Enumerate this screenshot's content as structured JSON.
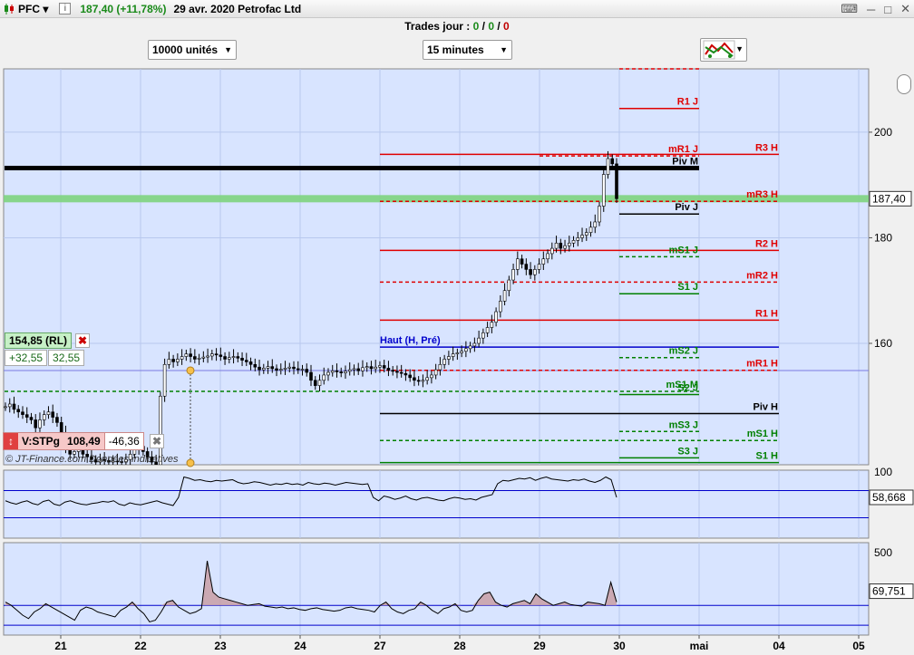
{
  "titlebar": {
    "symbol": "PFC",
    "info_icon": "i",
    "quote": "187,40 (+11,78%)",
    "date_name": "29 avr. 2020 Petrofac Ltd",
    "icons": [
      "keyboard-icon",
      "minimize-icon",
      "maximize-icon",
      "close-icon"
    ]
  },
  "trades": {
    "label": "Trades jour : ",
    "v1": "0",
    "sep1": " / ",
    "v2": "0",
    "sep2": " / ",
    "v3": "0"
  },
  "toolbar": {
    "quantity": "10000 unités",
    "timeframe": "15 minutes"
  },
  "rl_panel": {
    "label": "154,85 (RL)",
    "v1": "+32,55",
    "v2": "32,55",
    "close": "✖"
  },
  "stpg_panel": {
    "label": "V:STPg",
    "v1": "108,49",
    "v2": "-46,36",
    "close": "✖"
  },
  "copyright": "© JT-Finance.com  Données indicatives",
  "colors": {
    "bg": "#d8e4ff",
    "red": "#e00000",
    "green": "#008000",
    "blue": "#0000cc",
    "black": "#000000",
    "highlight": "#7ed37e"
  },
  "chart_data": [
    {
      "type": "line",
      "series_type": "candlestick",
      "x_ticks": [
        "21",
        "22",
        "23",
        "24",
        "27",
        "28",
        "29",
        "30",
        "mai",
        "04",
        "05"
      ],
      "y_ticks": [
        160,
        180,
        200
      ],
      "ylim": [
        137,
        212
      ],
      "last_price_label": "187,40",
      "close": [
        148,
        148.5,
        147.5,
        147,
        146.5,
        146,
        145.5,
        144,
        145.5,
        146.5,
        147,
        146,
        145,
        143,
        140,
        139,
        139.5,
        140,
        139,
        138.5,
        138,
        137.5,
        138,
        137.8,
        137.5,
        137.7,
        137.6,
        137.5,
        138,
        139,
        140,
        140.5,
        139.5,
        138.5,
        137.5,
        137,
        150,
        156,
        157,
        156.5,
        157,
        157.5,
        158,
        157.5,
        157,
        157.2,
        157.4,
        157.6,
        158,
        157.8,
        157.5,
        157,
        157.3,
        157.5,
        157.2,
        156.8,
        156.5,
        156,
        155.5,
        155,
        155.3,
        155.6,
        155.2,
        154.9,
        155.1,
        155.3,
        155.5,
        155.2,
        155,
        155.1,
        154.5,
        153,
        152,
        153,
        154,
        154.5,
        154.8,
        154.6,
        154.4,
        154.7,
        155,
        155.2,
        154.8,
        155.4,
        155.6,
        155.2,
        155.5,
        155.8,
        155.3,
        154.9,
        154.7,
        154.5,
        154.3,
        154,
        153.5,
        153,
        152.8,
        153,
        153.5,
        154,
        155,
        156,
        157,
        157.5,
        158,
        158.2,
        158.5,
        159,
        159.5,
        160,
        161,
        162,
        163,
        164,
        166,
        168,
        170,
        172,
        174,
        176,
        175,
        174,
        173,
        174,
        175,
        176,
        177,
        178,
        179,
        178,
        178.5,
        179,
        179.5,
        180,
        180.5,
        181,
        182,
        183,
        186,
        192,
        195,
        194,
        187.4
      ],
      "levels": [
        {
          "name": "R1 J",
          "value": 204.5,
          "color": "red",
          "style": "solid",
          "x_from": "30",
          "x_to": "mai"
        },
        {
          "name": "",
          "value": 212,
          "color": "red",
          "style": "dashed",
          "x_from": "30",
          "x_to": "mai"
        },
        {
          "name": "R3 H",
          "value": 195.8,
          "color": "red",
          "style": "solid",
          "x_from": "27",
          "x_to": "04"
        },
        {
          "name": "mR1 J",
          "value": 195.5,
          "color": "red",
          "style": "dashed",
          "x_from": "29",
          "x_to": "mai"
        },
        {
          "name": "Piv M",
          "value": 193.2,
          "color": "black",
          "style": "solid",
          "x_from": "start",
          "x_to": "mai",
          "thick": true
        },
        {
          "name": "mR3 H",
          "value": 186.9,
          "color": "red",
          "style": "dashed",
          "x_from": "27",
          "x_to": "04"
        },
        {
          "name": "Piv J",
          "value": 184.5,
          "color": "black",
          "style": "solid",
          "x_from": "30",
          "x_to": "mai"
        },
        {
          "name": "R2 H",
          "value": 177.6,
          "color": "red",
          "style": "solid",
          "x_from": "27",
          "x_to": "04"
        },
        {
          "name": "mS1 J",
          "value": 176.4,
          "color": "green",
          "style": "dashed",
          "x_from": "30",
          "x_to": "mai"
        },
        {
          "name": "mR2 H",
          "value": 171.6,
          "color": "red",
          "style": "dashed",
          "x_from": "27",
          "x_to": "04"
        },
        {
          "name": "S1 J",
          "value": 169.4,
          "color": "green",
          "style": "solid",
          "x_from": "30",
          "x_to": "mai"
        },
        {
          "name": "R1 H",
          "value": 164.4,
          "color": "red",
          "style": "solid",
          "x_from": "27",
          "x_to": "04"
        },
        {
          "name": "Haut (H, Pré)",
          "value": 159.3,
          "color": "blue",
          "style": "solid",
          "x_from": "27",
          "x_to": "04",
          "label_left": true
        },
        {
          "name": "mS2 J",
          "value": 157.3,
          "color": "green",
          "style": "dashed",
          "x_from": "30",
          "x_to": "mai"
        },
        {
          "name": "mR1 H",
          "value": 154.9,
          "color": "red",
          "style": "dashed",
          "x_from": "27",
          "x_to": "04"
        },
        {
          "name": "mS1 M",
          "value": 150.9,
          "color": "green",
          "style": "dashed",
          "x_from": "start",
          "x_to": "mai"
        },
        {
          "name": "S2 J",
          "value": 150.3,
          "color": "green",
          "style": "solid",
          "x_from": "30",
          "x_to": "mai"
        },
        {
          "name": "Piv H",
          "value": 146.7,
          "color": "black",
          "style": "solid",
          "x_from": "27",
          "x_to": "04"
        },
        {
          "name": "mS3 J",
          "value": 143.3,
          "color": "green",
          "style": "dashed",
          "x_from": "30",
          "x_to": "mai"
        },
        {
          "name": "mS1 H",
          "value": 141.6,
          "color": "green",
          "style": "dashed",
          "x_from": "27",
          "x_to": "04"
        },
        {
          "name": "S3 J",
          "value": 138.3,
          "color": "green",
          "style": "solid",
          "x_from": "30",
          "x_to": "mai"
        },
        {
          "name": "S1 H",
          "value": 137.4,
          "color": "green",
          "style": "solid",
          "x_from": "27",
          "x_to": "04"
        }
      ],
      "rl_value": 154.85
    },
    {
      "type": "line",
      "name": "",
      "y_ticks": [
        100
      ],
      "last_label": "58,668",
      "values": [
        55,
        52,
        50,
        53,
        55,
        51,
        49,
        54,
        56,
        50,
        48,
        53,
        55,
        52,
        50,
        49,
        51,
        52,
        54,
        53,
        55,
        50,
        48,
        52,
        50,
        49,
        51,
        53,
        55,
        52,
        50,
        48,
        60,
        90,
        88,
        85,
        86,
        84,
        83,
        85,
        84,
        85,
        86,
        82,
        80,
        81,
        83,
        82,
        80,
        78,
        80,
        79,
        81,
        79,
        80,
        78,
        82,
        80,
        79,
        81,
        80,
        78,
        80,
        82,
        81,
        80,
        79,
        80,
        60,
        55,
        62,
        60,
        57,
        59,
        62,
        58,
        56,
        59,
        60,
        58,
        56,
        55,
        58,
        60,
        59,
        57,
        58,
        56,
        60,
        62,
        64,
        80,
        85,
        84,
        86,
        88,
        87,
        89,
        85,
        88,
        90,
        87,
        86,
        85,
        84,
        86,
        85,
        87,
        84,
        82,
        85,
        90,
        86,
        60
      ]
    },
    {
      "type": "area",
      "name": "",
      "y_ticks": [
        500
      ],
      "last_label": "69,751",
      "values": [
        200,
        180,
        150,
        120,
        100,
        140,
        160,
        190,
        170,
        150,
        130,
        110,
        90,
        150,
        170,
        160,
        140,
        130,
        120,
        110,
        150,
        170,
        200,
        160,
        130,
        80,
        90,
        140,
        200,
        210,
        170,
        150,
        130,
        140,
        160,
        450,
        260,
        230,
        220,
        210,
        200,
        190,
        180,
        185,
        190,
        175,
        170,
        165,
        170,
        160,
        165,
        155,
        150,
        160,
        165,
        155,
        150,
        145,
        150,
        165,
        170,
        160,
        155,
        150,
        140,
        180,
        200,
        160,
        140,
        130,
        150,
        160,
        200,
        180,
        150,
        130,
        160,
        170,
        190,
        150,
        140,
        150,
        210,
        250,
        260,
        200,
        180,
        170,
        190,
        200,
        210,
        190,
        250,
        220,
        200,
        180,
        190,
        200,
        185,
        180,
        175,
        200,
        195,
        190,
        180,
        320,
        200
      ]
    }
  ]
}
